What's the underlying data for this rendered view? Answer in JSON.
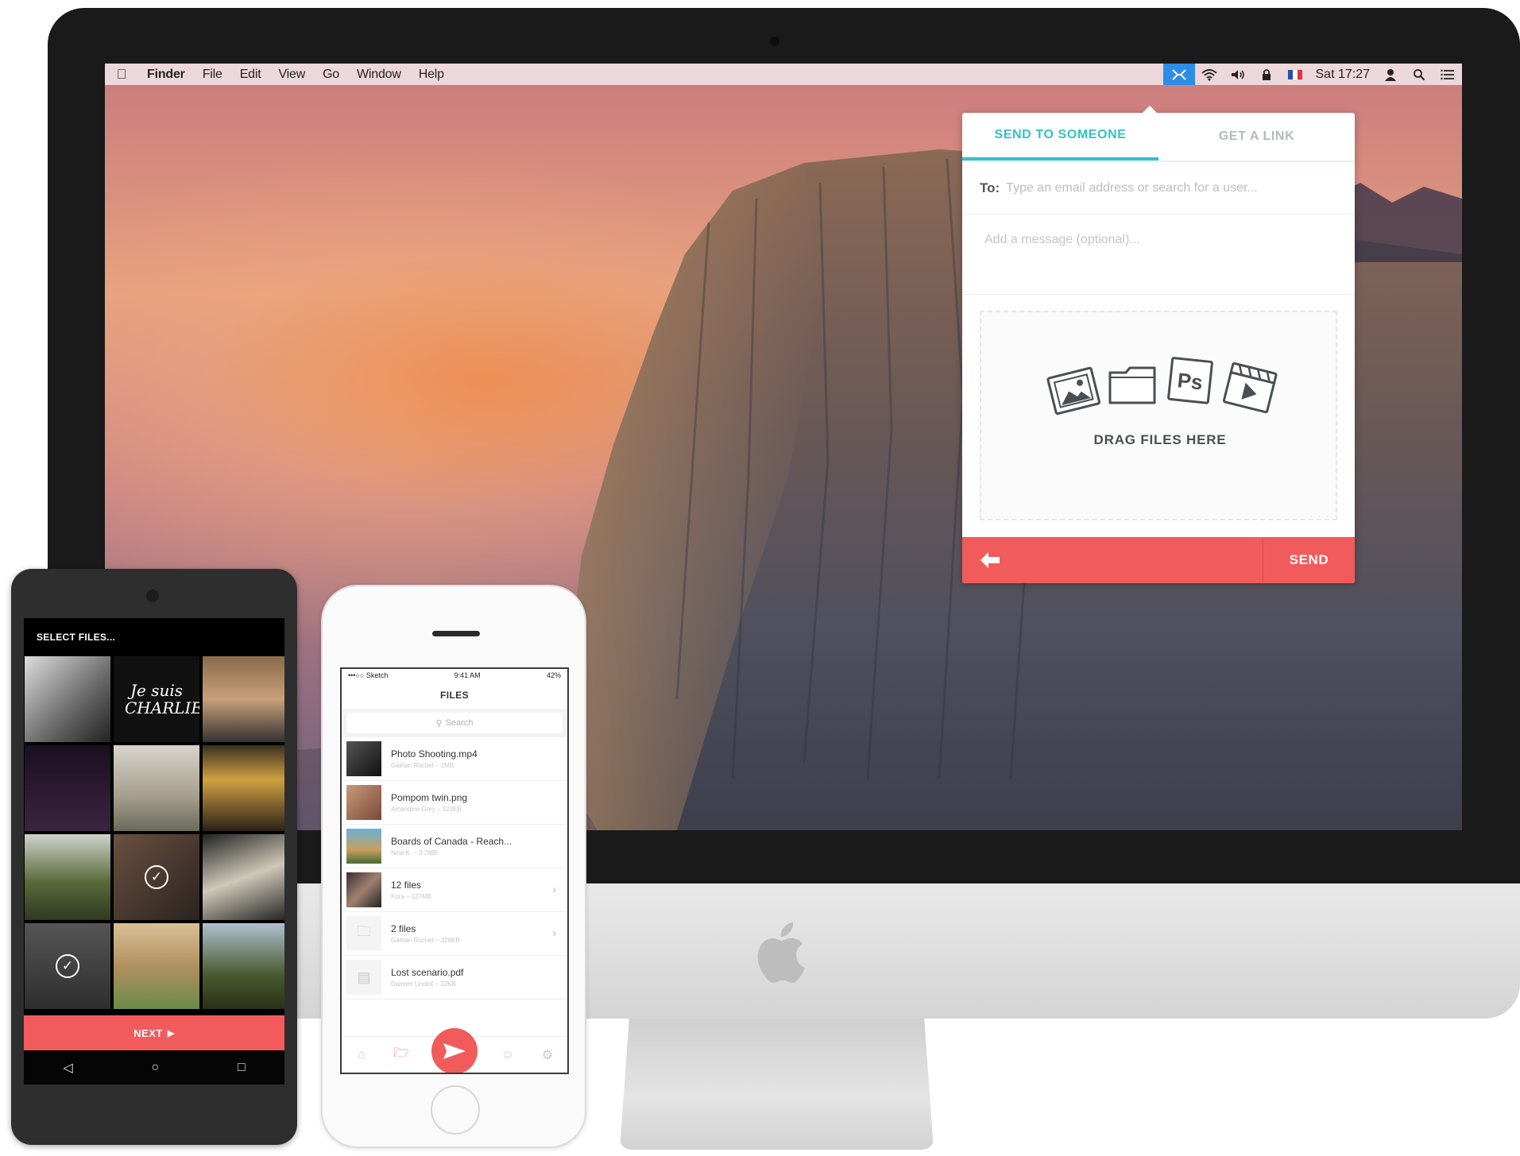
{
  "menubar": {
    "app_name": "Finder",
    "items": [
      "File",
      "Edit",
      "View",
      "Go",
      "Window",
      "Help"
    ],
    "clock": "Sat 17:27",
    "icons": [
      "app-status-icon",
      "wifi-icon",
      "volume-icon",
      "lock-icon",
      "flag-fr-icon",
      "user-icon",
      "spotlight-icon",
      "notification-list-icon"
    ]
  },
  "popover": {
    "tabs": [
      {
        "label": "SEND TO SOMEONE",
        "active": true
      },
      {
        "label": "GET A LINK",
        "active": false
      }
    ],
    "to_label": "To:",
    "to_placeholder": "Type an email address or search for a user...",
    "message_placeholder": "Add a message (optional)...",
    "drop_label": "DRAG FILES HERE",
    "drop_icons": [
      "image-icon",
      "folder-icon",
      "photoshop-icon",
      "video-icon"
    ],
    "send_label": "SEND",
    "accent": "#36c0c8",
    "action_color": "#f15b5b"
  },
  "android": {
    "header": "SELECT FILES...",
    "photo_overlay_text": "Je suis CHARLIE",
    "next_label": "NEXT",
    "selected_indices": [
      7,
      9
    ],
    "photo_count": 12
  },
  "iphone": {
    "status": {
      "carrier": "•••○○ Sketch",
      "time": "9:41 AM",
      "battery": "42%"
    },
    "title": "FILES",
    "search_placeholder": "Search",
    "files": [
      {
        "name": "Photo Shooting.mp4",
        "meta": "Gaëtan Rochet – 1MB",
        "chevron": false
      },
      {
        "name": "Pompom twin.png",
        "meta": "Amandine Grey – 323KB",
        "chevron": false
      },
      {
        "name": "Boards of Canada - Reach...",
        "meta": "Nina K. – 3.2MB",
        "chevron": false
      },
      {
        "name": "12 files",
        "meta": "Kora – 127MB",
        "chevron": true
      },
      {
        "name": "2 files",
        "meta": "Gaëtan Rochet – 320KB",
        "chevron": true
      },
      {
        "name": "Lost scenario.pdf",
        "meta": "Damien Lindeit – 22KB",
        "chevron": false
      }
    ],
    "tabbar": [
      "home-icon",
      "folder-icon",
      "send-icon",
      "profile-icon",
      "settings-icon"
    ]
  }
}
